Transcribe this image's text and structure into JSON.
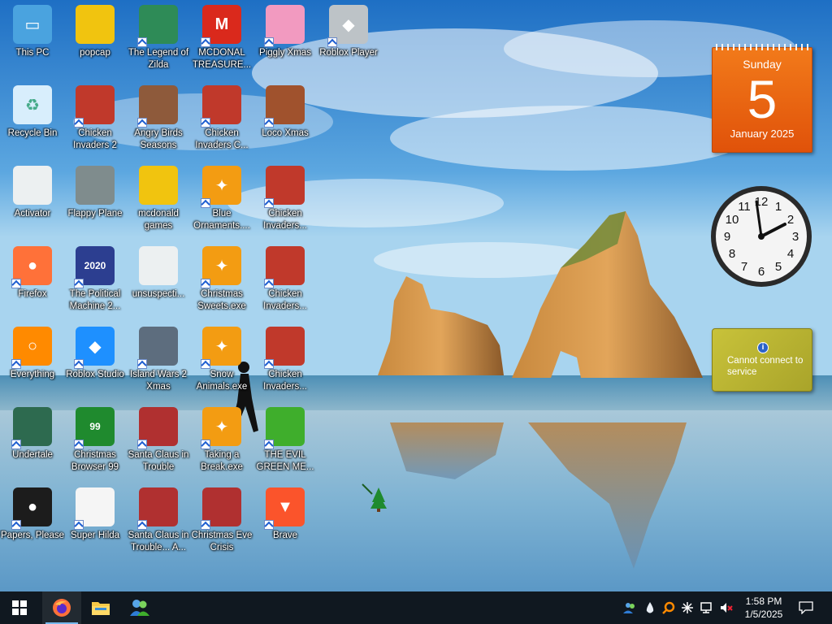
{
  "desktop_icons": [
    {
      "label": "This PC",
      "icon": "computer-icon",
      "shortcut": false
    },
    {
      "label": "popcap",
      "icon": "folder-icon",
      "shortcut": false
    },
    {
      "label": "The Legend of Zilda",
      "icon": "game-icon",
      "shortcut": true
    },
    {
      "label": "MCDONAL TREASURE...",
      "icon": "mcdonalds-icon",
      "shortcut": true
    },
    {
      "label": "Piggly Xmas",
      "icon": "pig-icon",
      "shortcut": true
    },
    {
      "label": "Roblox Player",
      "icon": "roblox-icon",
      "shortcut": true
    },
    {
      "label": "Recycle Bin",
      "icon": "recycle-bin-icon",
      "shortcut": false
    },
    {
      "label": "Chicken Invaders 2",
      "icon": "chicken-icon",
      "shortcut": true
    },
    {
      "label": "Angry Birds Seasons",
      "icon": "angry-birds-icon",
      "shortcut": true
    },
    {
      "label": "Chicken Invaders C...",
      "icon": "chicken-icon",
      "shortcut": true
    },
    {
      "label": "Loco Xmas",
      "icon": "bear-icon",
      "shortcut": true
    },
    {
      "label": "Activator",
      "icon": "file-icon",
      "shortcut": false
    },
    {
      "label": "Flappy Plane",
      "icon": "plane-icon",
      "shortcut": false
    },
    {
      "label": "mcdonald games",
      "icon": "folder-icon",
      "shortcut": false
    },
    {
      "label": "Blue Ornaments....",
      "icon": "exe-icon",
      "shortcut": true
    },
    {
      "label": "Chicken Invaders...",
      "icon": "chicken-icon",
      "shortcut": true
    },
    {
      "label": "Firefox",
      "icon": "firefox-icon",
      "shortcut": true
    },
    {
      "label": "The Political Machine 2...",
      "icon": "political-icon",
      "shortcut": true
    },
    {
      "label": "unsuspecti...",
      "icon": "file-icon",
      "shortcut": false
    },
    {
      "label": "Christmas Sweets.exe",
      "icon": "exe-icon",
      "shortcut": true
    },
    {
      "label": "Chicken Invaders...",
      "icon": "chicken-icon",
      "shortcut": true
    },
    {
      "label": "Everything",
      "icon": "search-icon",
      "shortcut": true
    },
    {
      "label": "Roblox Studio",
      "icon": "roblox-studio-icon",
      "shortcut": true
    },
    {
      "label": "Island Wars 2 Xmas",
      "icon": "island-icon",
      "shortcut": true
    },
    {
      "label": "Snow Animals.exe",
      "icon": "exe-icon",
      "shortcut": true
    },
    {
      "label": "Chicken Invaders...",
      "icon": "chicken-icon",
      "shortcut": true
    },
    {
      "label": "Undertale",
      "icon": "undertale-icon",
      "shortcut": true
    },
    {
      "label": "Christmas Browser 99",
      "icon": "tree-icon",
      "shortcut": true
    },
    {
      "label": "Santa Claus in Trouble",
      "icon": "santa-icon",
      "shortcut": true
    },
    {
      "label": "Taking a Break.exe",
      "icon": "exe-icon",
      "shortcut": true
    },
    {
      "label": "THE EVIL GREEN ME...",
      "icon": "users-icon",
      "shortcut": true
    },
    {
      "label": "Papers, Please",
      "icon": "papers-icon",
      "shortcut": true
    },
    {
      "label": "Super Hilda",
      "icon": "hilda-icon",
      "shortcut": true
    },
    {
      "label": "Santa Claus in Trouble... A...",
      "icon": "santa-icon",
      "shortcut": true
    },
    {
      "label": "Christmas Eve Crisis",
      "icon": "santa-icon",
      "shortcut": true
    },
    {
      "label": "Brave",
      "icon": "brave-icon",
      "shortcut": true
    }
  ],
  "gadgets": {
    "calendar": {
      "day_name": "Sunday",
      "day_number": "5",
      "month_year": "January 2025"
    },
    "clock": {
      "time": "1:58"
    },
    "weather": {
      "message": "Cannot connect to service"
    }
  },
  "taskbar": {
    "start_icon": "windows-logo-icon",
    "pinned": [
      {
        "name": "firefox",
        "icon": "firefox-icon",
        "active": true
      },
      {
        "name": "file-explorer",
        "icon": "folder-icon",
        "active": false
      },
      {
        "name": "messenger",
        "icon": "users-icon",
        "active": false
      }
    ],
    "tray": {
      "time": "1:58 PM",
      "date": "1/5/2025"
    }
  },
  "colors": {
    "taskbar": "#101820",
    "calendar": "#f0701a",
    "weather": "#bdb634"
  }
}
